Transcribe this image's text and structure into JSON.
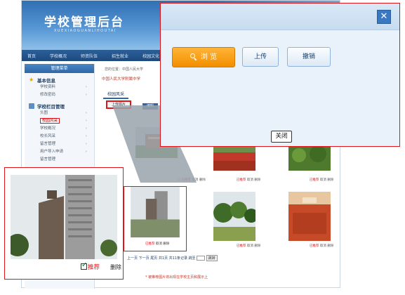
{
  "header": {
    "title": "学校管理后台",
    "subtitle": "XUEXIAOGUANLIHOUTAI"
  },
  "nav": [
    "首页",
    "学校概况",
    "师资队伍",
    "招生就业",
    "校园文化"
  ],
  "sidebar": {
    "heading": "管理菜单",
    "groups": [
      {
        "label": "基本信息",
        "icon": "star-icon",
        "items": [
          "学校资料",
          "修改密码"
        ]
      },
      {
        "label": "学校栏目管理",
        "icon": "document-icon",
        "items": [
          "头图",
          "校园风采",
          "学校概况",
          "校长风采",
          "留言管理",
          "用户导入申请",
          "留言管理"
        ]
      }
    ],
    "active_item": "校园风采"
  },
  "content": {
    "breadcrumb": "您的位置：中国人民大学",
    "school": "中国人民大学附属中学",
    "section_tab": "校园风采",
    "upload_button": "上传图片",
    "edit_button": "编辑",
    "thumb_actions": {
      "recommended": "已推荐",
      "cancel": "取消",
      "delete": "删除"
    },
    "pager": {
      "prev": "上一页",
      "next": "下一页",
      "last": "尾页",
      "summary": "共1页 共11条记录 跳至",
      "go": "跳转"
    },
    "footnote": "* 被推荐图片将出现在学校主页和展示上"
  },
  "dialog": {
    "close_x": "✕",
    "browse": "浏 览",
    "upload": "上传",
    "cancel": "撤销",
    "close": "关闭"
  },
  "zoom": {
    "recommend": "推荐",
    "delete": "删除"
  },
  "colors": {
    "highlight": "#e0151a",
    "browse": "#f28e00",
    "nav": "#1d4a7e"
  }
}
